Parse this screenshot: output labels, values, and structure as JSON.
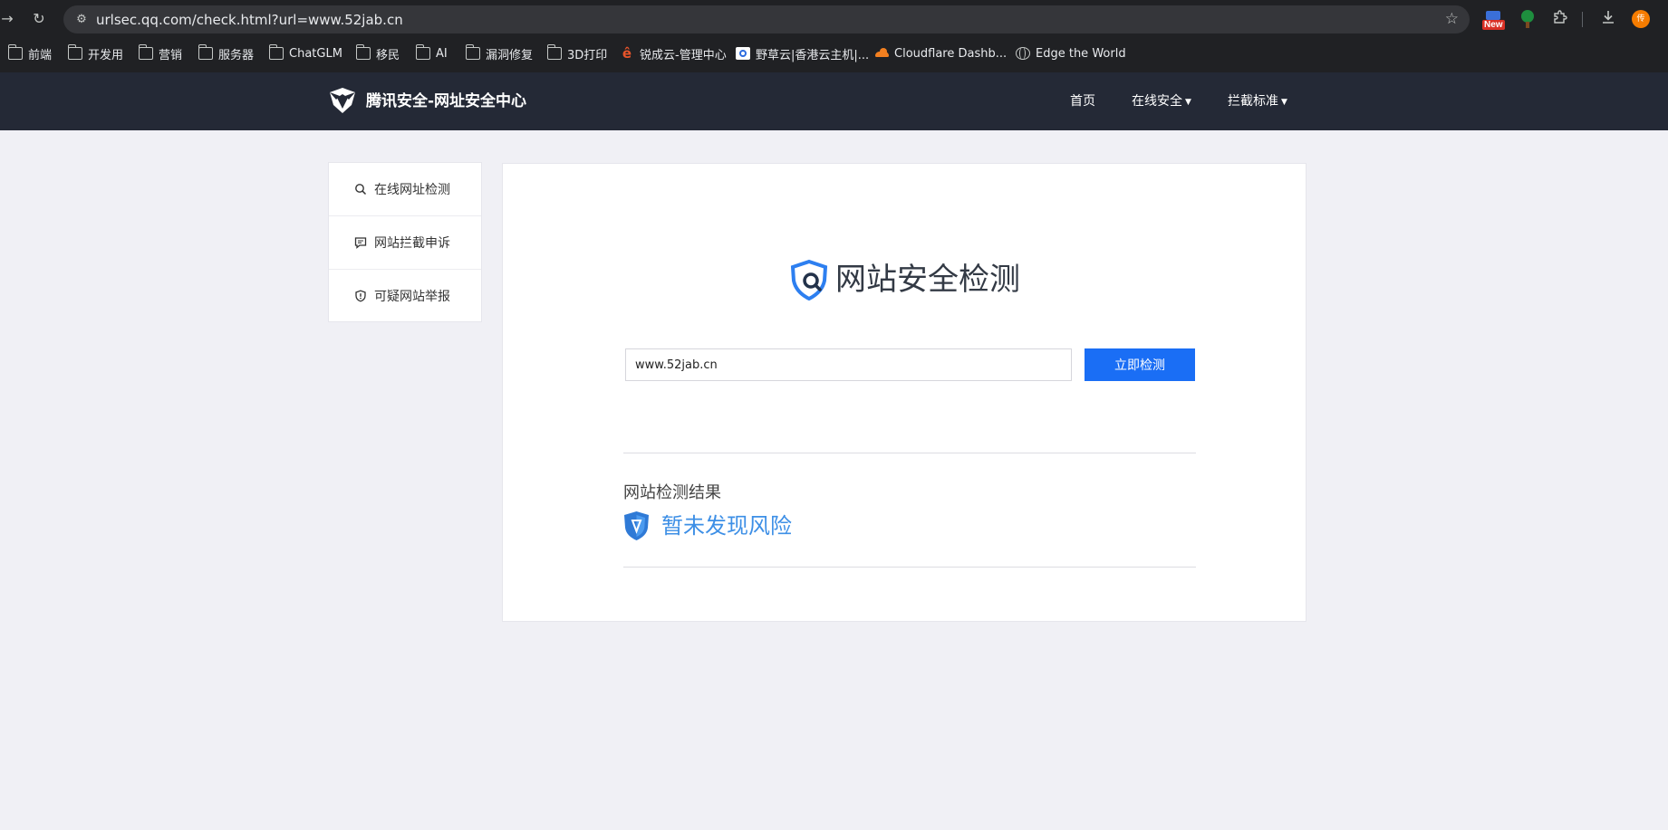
{
  "browser": {
    "url": "urlsec.qq.com/check.html?url=www.52jab.cn",
    "extension_new_label": "New",
    "avatar_initial": "传",
    "bookmarks": [
      {
        "label": "前端",
        "icon": "folder-icon"
      },
      {
        "label": "开发用",
        "icon": "folder-icon"
      },
      {
        "label": "营销",
        "icon": "folder-icon"
      },
      {
        "label": "服务器",
        "icon": "folder-icon"
      },
      {
        "label": "ChatGLM",
        "icon": "folder-icon"
      },
      {
        "label": "移民",
        "icon": "folder-icon"
      },
      {
        "label": "AI",
        "icon": "folder-icon"
      },
      {
        "label": "漏洞修复",
        "icon": "folder-icon"
      },
      {
        "label": "3D打印",
        "icon": "folder-icon"
      },
      {
        "label": "锐成云-管理中心",
        "icon": "e-icon"
      },
      {
        "label": "野草云|香港云主机|...",
        "icon": "eye-icon"
      },
      {
        "label": "Cloudflare Dashb...",
        "icon": "cloudflare-icon"
      },
      {
        "label": "Edge the World",
        "icon": "globe-icon"
      }
    ]
  },
  "site": {
    "logo_text": "腾讯安全-网址安全中心",
    "nav": {
      "home": "首页",
      "online_security": "在线安全",
      "block_standards": "拦截标准"
    },
    "sidebar": [
      {
        "label": "在线网址检测"
      },
      {
        "label": "网站拦截申诉"
      },
      {
        "label": "可疑网站举报"
      }
    ],
    "main": {
      "title": "网站安全检测",
      "input_value": "www.52jab.cn",
      "check_button": "立即检测",
      "result_label": "网站检测结果",
      "result_text": "暂未发现风险"
    }
  },
  "colors": {
    "header_bg": "#242936",
    "primary": "#1a6ef5",
    "result": "#3d8fe6",
    "page_bg": "#f0f0f5"
  }
}
